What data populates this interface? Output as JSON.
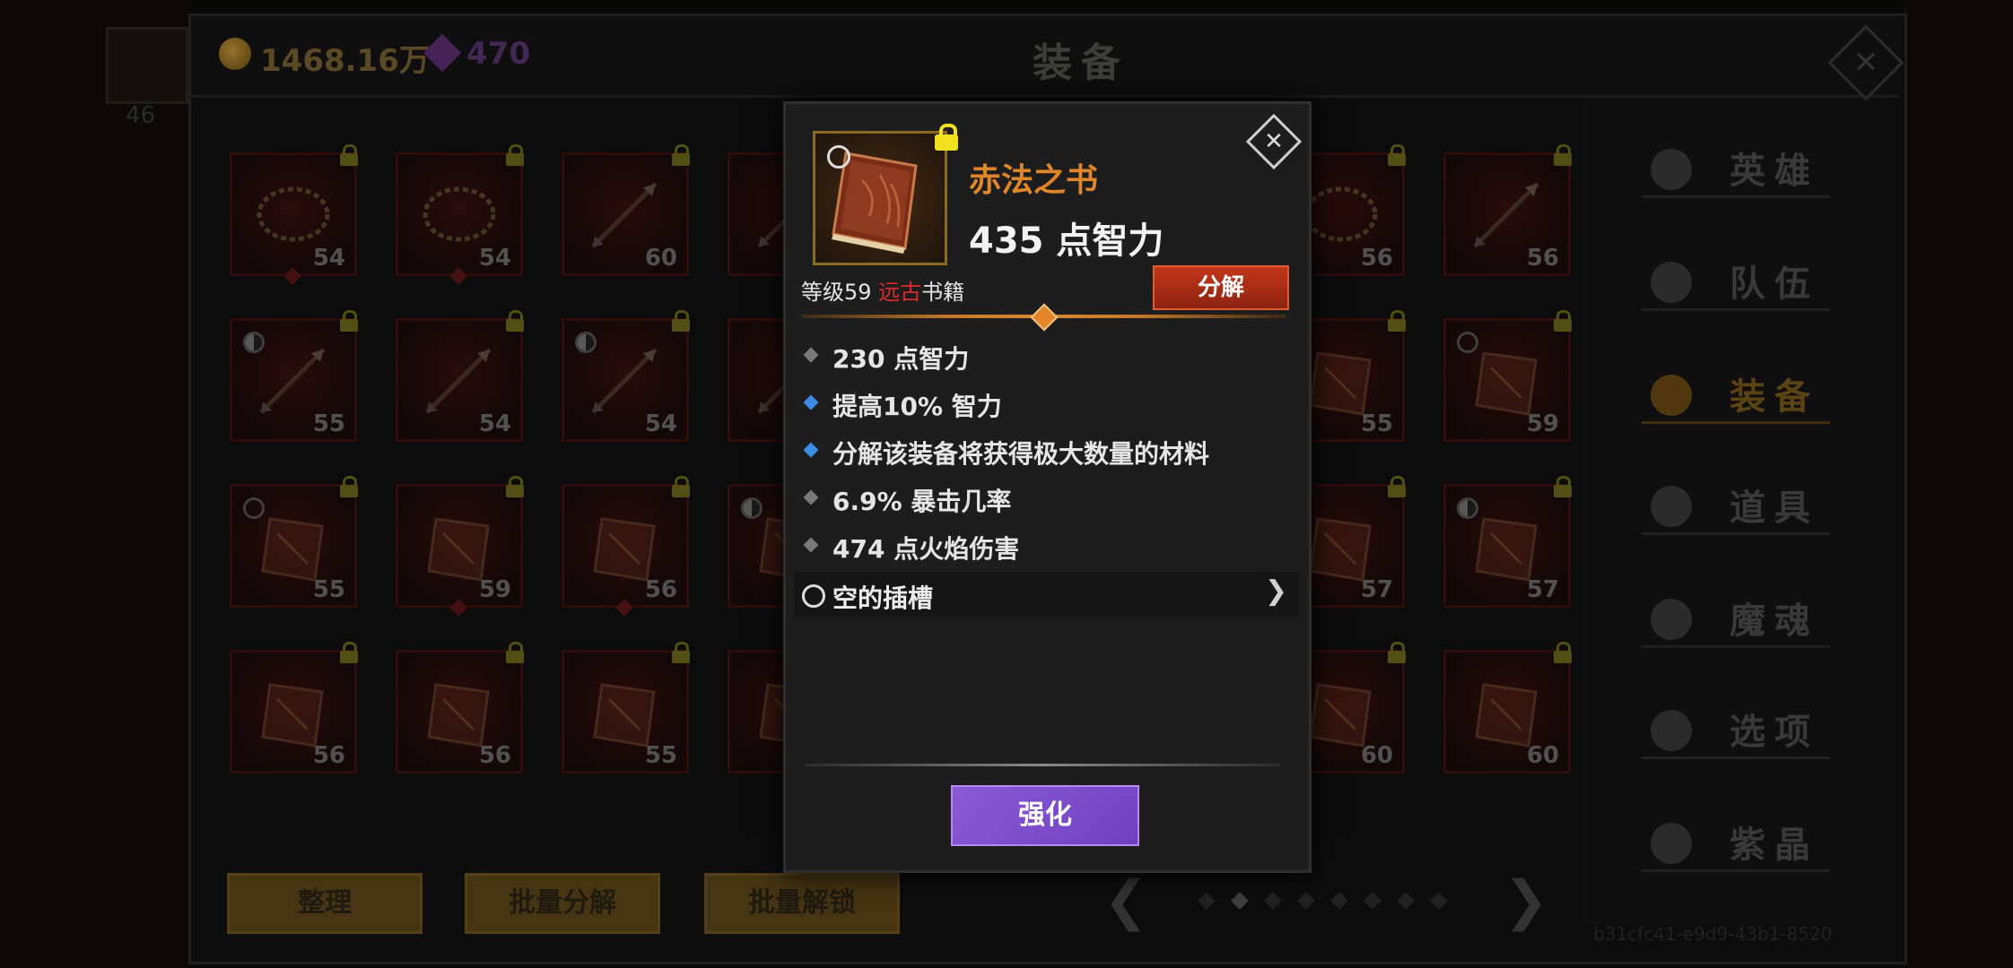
{
  "currency": {
    "gold": "1468.16万",
    "gems": "470"
  },
  "header": {
    "title": "装备"
  },
  "left_strip": {
    "level": "46"
  },
  "grid": {
    "rows": [
      [
        {
          "level": "54",
          "locked": true,
          "marker": "dot",
          "art": "chain"
        },
        {
          "level": "54",
          "locked": true,
          "marker": "dot",
          "art": "chain"
        },
        {
          "level": "60",
          "locked": true,
          "marker": "",
          "art": "arrow"
        },
        {
          "level": "",
          "locked": true,
          "marker": "",
          "art": "arrow"
        },
        {
          "level": "56",
          "locked": true,
          "marker": "",
          "art": "chain"
        },
        {
          "level": "56",
          "locked": true,
          "marker": "",
          "art": "arrow"
        }
      ],
      [
        {
          "level": "55",
          "locked": true,
          "marker": "yinyang",
          "art": "arrow"
        },
        {
          "level": "54",
          "locked": true,
          "marker": "",
          "art": "arrow"
        },
        {
          "level": "54",
          "locked": true,
          "marker": "yinyang",
          "art": "arrow"
        },
        {
          "level": "",
          "locked": true,
          "marker": "",
          "art": "arrow"
        },
        {
          "level": "55",
          "locked": true,
          "marker": "",
          "art": "book"
        },
        {
          "level": "59",
          "locked": true,
          "marker": "circle",
          "art": "book"
        }
      ],
      [
        {
          "level": "55",
          "locked": true,
          "marker": "circle",
          "art": "book"
        },
        {
          "level": "59",
          "locked": true,
          "marker": "dot",
          "art": "book"
        },
        {
          "level": "56",
          "locked": true,
          "marker": "dot",
          "art": "book"
        },
        {
          "level": "",
          "locked": true,
          "marker": "yinyang",
          "art": "book"
        },
        {
          "level": "57",
          "locked": true,
          "marker": "",
          "art": "book"
        },
        {
          "level": "57",
          "locked": true,
          "marker": "yinyang",
          "art": "book"
        }
      ],
      [
        {
          "level": "56",
          "locked": true,
          "marker": "",
          "art": "book"
        },
        {
          "level": "56",
          "locked": true,
          "marker": "",
          "art": "book"
        },
        {
          "level": "55",
          "locked": true,
          "marker": "",
          "art": "book"
        },
        {
          "level": "",
          "locked": true,
          "marker": "",
          "art": "book"
        },
        {
          "level": "60",
          "locked": true,
          "marker": "",
          "art": "book"
        },
        {
          "level": "60",
          "locked": true,
          "marker": "",
          "art": "book"
        }
      ]
    ]
  },
  "bottom_buttons": {
    "sort": "整理",
    "batch_decompose": "批量分解",
    "batch_unlock": "批量解锁"
  },
  "pagination": {
    "current": 2,
    "total": 8
  },
  "side_menu": [
    {
      "label": "英雄",
      "icon": "heroes-icon"
    },
    {
      "label": "队伍",
      "icon": "flag-icon"
    },
    {
      "label": "装备",
      "icon": "helmet-icon",
      "active": true
    },
    {
      "label": "道具",
      "icon": "bag-icon"
    },
    {
      "label": "魔魂",
      "icon": "flame-icon"
    },
    {
      "label": "选项",
      "icon": "gear-icon"
    },
    {
      "label": "紫晶",
      "icon": "crystal-icon"
    }
  ],
  "serial": "b31cfc41-e9d9-43b1-8520",
  "item": {
    "name": "赤法之书",
    "main_stat": "435 点智力",
    "level_prefix": "等级59",
    "rarity": "远古",
    "category": "书籍",
    "decompose_label": "分解",
    "attributes": [
      {
        "text": "230 点智力",
        "bullet": "#7a7a7a"
      },
      {
        "text": "提高10% 智力",
        "bullet": "#3b8ee6"
      },
      {
        "text": "分解该装备将获得极大数量的材料",
        "bullet": "#3b8ee6"
      },
      {
        "text": "6.9% 暴击几率",
        "bullet": "#7a7a7a"
      },
      {
        "text": "474 点火焰伤害",
        "bullet": "#7a7a7a"
      }
    ],
    "socket_label": "空的插槽",
    "enhance_label": "强化"
  }
}
